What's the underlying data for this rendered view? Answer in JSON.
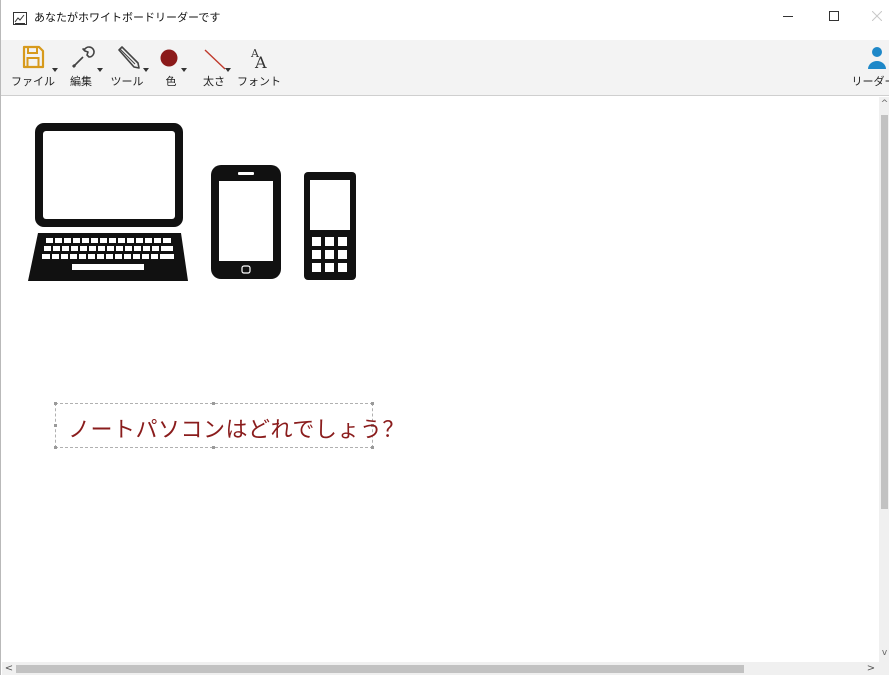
{
  "window": {
    "title": "あなたがホワイトボードリーダーです",
    "icon": "whiteboard-app-icon",
    "controls": {
      "minimize": "minimize-icon",
      "maximize": "maximize-icon",
      "close": "close-icon"
    }
  },
  "toolbar": {
    "items": [
      {
        "label": "ファイル",
        "icon": "save-icon"
      },
      {
        "label": "編集",
        "icon": "wrench-icon"
      },
      {
        "label": "ツール",
        "icon": "pen-icon"
      },
      {
        "label": "色",
        "icon": "color-dot-icon",
        "color": "#8b1a1a"
      },
      {
        "label": "太さ",
        "icon": "line-width-icon"
      },
      {
        "label": "フォント",
        "icon": "font-icon"
      }
    ],
    "leader": {
      "label": "リーダー",
      "icon": "user-icon",
      "color": "#1e88c8"
    }
  },
  "canvas": {
    "images": [
      "laptop-icon",
      "smartphone-icon",
      "feature-phone-icon"
    ],
    "text": "ノートパソコンはどれでしょう？",
    "text_color": "#8a1c1c"
  },
  "scrollbars": {
    "up": "^",
    "down": "v",
    "left": "<",
    "right": ">"
  }
}
